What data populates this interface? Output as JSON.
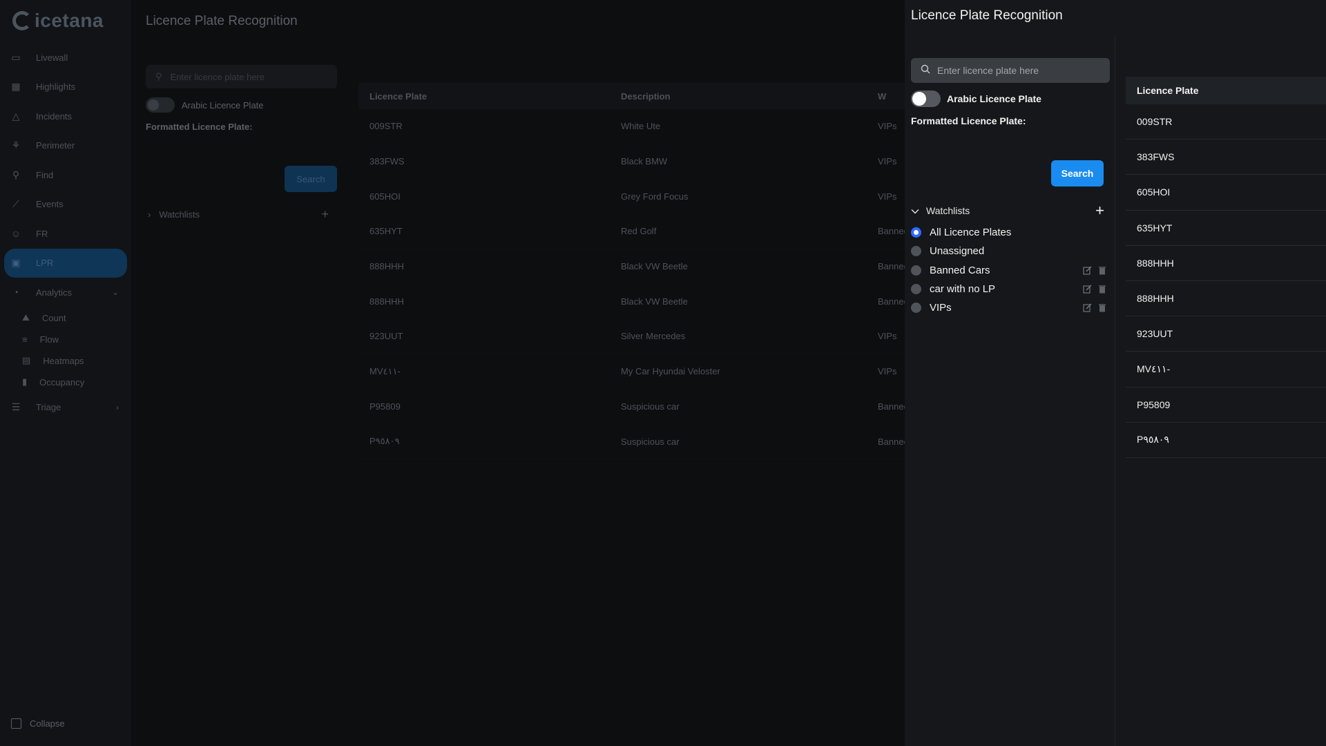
{
  "app": {
    "logo_text": "icetana",
    "nav": [
      {
        "label": "Livewall",
        "icon": "monitor-icon"
      },
      {
        "label": "Highlights",
        "icon": "grid-icon"
      },
      {
        "label": "Incidents",
        "icon": "warning-icon"
      },
      {
        "label": "Perimeter",
        "icon": "person-run-icon"
      },
      {
        "label": "Find",
        "icon": "person-search-icon"
      },
      {
        "label": "Events",
        "icon": "line-chart-icon"
      },
      {
        "label": "FR",
        "icon": "face-scan-icon"
      },
      {
        "label": "LPR",
        "icon": "car-scan-icon",
        "active": true
      },
      {
        "label": "Analytics",
        "icon": "pie-chart-icon"
      }
    ],
    "analytics_sub": [
      {
        "label": "Count",
        "icon": "area-chart-icon"
      },
      {
        "label": "Flow",
        "icon": "flow-icon"
      },
      {
        "label": "Heatmaps",
        "icon": "heatmap-icon"
      },
      {
        "label": "Occupancy",
        "icon": "bar-chart-icon"
      }
    ],
    "triage_label": "Triage",
    "collapse_label": "Collapse"
  },
  "background_page": {
    "title": "Licence Plate Recognition",
    "search_placeholder": "Enter licence plate here",
    "arabic_toggle_label": "Arabic Licence Plate",
    "formatted_label": "Formatted Licence Plate:",
    "search_button": "Search",
    "watchlists_label": "Watchlists",
    "table": {
      "columns": [
        "Licence Plate",
        "Description",
        "W"
      ],
      "rows": [
        {
          "plate": "009STR",
          "description": "White Ute",
          "watchlist": "VIPs"
        },
        {
          "plate": "383FWS",
          "description": "Black BMW",
          "watchlist": "VIPs"
        },
        {
          "plate": "605HOI",
          "description": "Grey Ford Focus",
          "watchlist": "VIPs"
        },
        {
          "plate": "635HYT",
          "description": "Red Golf",
          "watchlist": "Banned Cars"
        },
        {
          "plate": "888HHH",
          "description": "Black VW Beetle",
          "watchlist": "Banned Cars"
        },
        {
          "plate": "888HHH",
          "description": "Black VW Beetle",
          "watchlist": "Banned Cars"
        },
        {
          "plate": "923UUT",
          "description": "Silver Mercedes",
          "watchlist": "VIPs"
        },
        {
          "plate": "MV٤١١-",
          "description": "My Car Hyundai Veloster",
          "watchlist": "VIPs"
        },
        {
          "plate": "P95809",
          "description": "Suspicious car",
          "watchlist": "Banned Cars"
        },
        {
          "plate": "P٩٥٨٠٩",
          "description": "Suspicious car",
          "watchlist": "Banned Cars"
        }
      ]
    }
  },
  "drawer": {
    "title": "Licence Plate Recognition",
    "search_placeholder": "Enter licence plate here",
    "search_value": "",
    "arabic_toggle_label": "Arabic Licence Plate",
    "arabic_toggle_on": false,
    "formatted_label": "Formatted Licence Plate:",
    "search_button": "Search",
    "watchlists_label": "Watchlists",
    "watchlists": [
      {
        "label": "All Licence Plates",
        "selected": true,
        "editable": false
      },
      {
        "label": "Unassigned",
        "selected": false,
        "editable": false
      },
      {
        "label": "Banned Cars",
        "selected": false,
        "editable": true
      },
      {
        "label": "car with no LP",
        "selected": false,
        "editable": true
      },
      {
        "label": "VIPs",
        "selected": false,
        "editable": true
      }
    ],
    "table_header": "Licence Plate",
    "plates": [
      "009STR",
      "383FWS",
      "605HOI",
      "635HYT",
      "888HHH",
      "888HHH",
      "923UUT",
      "MV٤١١-",
      "P95809",
      "P٩٥٨٠٩"
    ]
  },
  "colors": {
    "accent": "#1a8cf0",
    "radio_selected": "#2f6bff",
    "drawer_bg": "#15171a"
  }
}
